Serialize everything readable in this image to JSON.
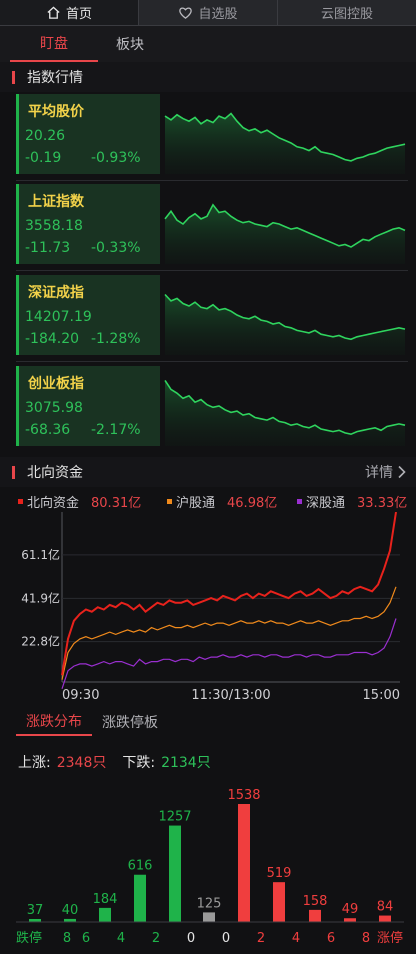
{
  "topnav": {
    "tabs": [
      {
        "label": "首页",
        "icon": "home-icon",
        "active": true
      },
      {
        "label": "自选股",
        "icon": "heart-icon",
        "active": false
      },
      {
        "label": "云图控股",
        "icon": "",
        "active": false
      }
    ]
  },
  "subtabs": [
    {
      "label": "盯盘",
      "active": true
    },
    {
      "label": "板块",
      "active": false
    }
  ],
  "index_section": {
    "title": "指数行情"
  },
  "indices": [
    {
      "name": "平均股价",
      "price": "20.26",
      "change": "-0.19",
      "percent": "-0.93%",
      "trend": [
        0.78,
        0.72,
        0.8,
        0.74,
        0.7,
        0.76,
        0.66,
        0.72,
        0.68,
        0.78,
        0.74,
        0.82,
        0.7,
        0.6,
        0.55,
        0.58,
        0.52,
        0.56,
        0.5,
        0.44,
        0.4,
        0.36,
        0.3,
        0.28,
        0.24,
        0.3,
        0.22,
        0.2,
        0.18,
        0.14,
        0.1,
        0.08,
        0.12,
        0.14,
        0.18,
        0.2,
        0.24,
        0.28,
        0.3,
        0.32,
        0.34
      ]
    },
    {
      "name": "上证指数",
      "price": "3558.18",
      "change": "-11.73",
      "percent": "-0.33%",
      "trend": [
        0.58,
        0.7,
        0.56,
        0.5,
        0.6,
        0.66,
        0.58,
        0.62,
        0.8,
        0.68,
        0.7,
        0.62,
        0.56,
        0.52,
        0.54,
        0.5,
        0.48,
        0.46,
        0.52,
        0.5,
        0.46,
        0.42,
        0.44,
        0.4,
        0.36,
        0.32,
        0.28,
        0.24,
        0.2,
        0.16,
        0.18,
        0.14,
        0.2,
        0.26,
        0.24,
        0.3,
        0.34,
        0.38,
        0.42,
        0.44,
        0.4
      ]
    },
    {
      "name": "深证成指",
      "price": "14207.19",
      "change": "-184.20",
      "percent": "-1.28%",
      "trend": [
        0.82,
        0.72,
        0.76,
        0.68,
        0.64,
        0.7,
        0.62,
        0.6,
        0.66,
        0.58,
        0.6,
        0.56,
        0.5,
        0.46,
        0.44,
        0.48,
        0.42,
        0.4,
        0.36,
        0.38,
        0.32,
        0.3,
        0.26,
        0.24,
        0.22,
        0.26,
        0.2,
        0.18,
        0.16,
        0.18,
        0.14,
        0.12,
        0.16,
        0.18,
        0.2,
        0.22,
        0.24,
        0.26,
        0.28,
        0.3,
        0.28
      ]
    },
    {
      "name": "创业板指",
      "price": "3075.98",
      "change": "-68.36",
      "percent": "-2.17%",
      "trend": [
        0.9,
        0.76,
        0.7,
        0.62,
        0.66,
        0.56,
        0.6,
        0.52,
        0.48,
        0.5,
        0.44,
        0.4,
        0.42,
        0.36,
        0.38,
        0.32,
        0.3,
        0.28,
        0.32,
        0.26,
        0.24,
        0.2,
        0.22,
        0.18,
        0.16,
        0.2,
        0.14,
        0.12,
        0.1,
        0.12,
        0.08,
        0.06,
        0.1,
        0.12,
        0.14,
        0.16,
        0.12,
        0.18,
        0.2,
        0.22,
        0.2
      ]
    }
  ],
  "north_section": {
    "title": "北向资金",
    "more": "详情"
  },
  "north_legend": [
    {
      "label": "北向资金",
      "value": "80.31亿",
      "color": "#e8221c"
    },
    {
      "label": "沪股通",
      "value": "46.98亿",
      "color": "#f08a1c"
    },
    {
      "label": "深股通",
      "value": "33.33亿",
      "color": "#9a2fd0"
    }
  ],
  "chart_data": [
    {
      "type": "line",
      "y_tick_labels": [
        "61.1亿",
        "41.9亿",
        "22.8亿"
      ],
      "y_ticks": [
        61.1,
        41.9,
        22.8
      ],
      "x_tick_labels": [
        "09:30",
        "11:30/13:00",
        "15:00"
      ],
      "ylim": [
        5,
        80
      ],
      "series": [
        {
          "name": "北向资金",
          "color": "#e8221c",
          "values": [
            8,
            24,
            32,
            35,
            37,
            36,
            38,
            37,
            39,
            38,
            40,
            39,
            37,
            39,
            36,
            38,
            40,
            39,
            41,
            40,
            40,
            41,
            39,
            40,
            41,
            42,
            41,
            43,
            42,
            41,
            43,
            44,
            42,
            44,
            43,
            45,
            44,
            43,
            42,
            44,
            45,
            43,
            44,
            46,
            44,
            42,
            43,
            45,
            44,
            46,
            47,
            46,
            45,
            48,
            55,
            63,
            80
          ]
        },
        {
          "name": "沪股通",
          "color": "#f08a1c",
          "values": [
            6,
            18,
            22,
            24,
            25,
            24,
            25,
            26,
            27,
            26,
            27,
            28,
            27,
            28,
            27,
            29,
            28,
            29,
            30,
            29,
            29,
            30,
            29,
            30,
            31,
            30,
            31,
            31,
            30,
            31,
            32,
            31,
            31,
            32,
            31,
            32,
            31,
            31,
            30,
            31,
            32,
            31,
            31,
            32,
            31,
            30,
            31,
            32,
            32,
            33,
            33,
            34,
            33,
            34,
            36,
            40,
            47
          ]
        },
        {
          "name": "深股通",
          "color": "#9a2fd0",
          "values": [
            2,
            10,
            12,
            13,
            13,
            12,
            13,
            14,
            13,
            14,
            14,
            13,
            12,
            15,
            13,
            14,
            14,
            15,
            15,
            14,
            15,
            15,
            14,
            16,
            15,
            16,
            16,
            17,
            16,
            16,
            17,
            16,
            17,
            17,
            16,
            17,
            17,
            16,
            16,
            17,
            17,
            16,
            17,
            17,
            16,
            16,
            17,
            17,
            17,
            18,
            18,
            18,
            17,
            18,
            20,
            25,
            33
          ]
        }
      ]
    },
    {
      "type": "bar",
      "categories": [
        "跌停",
        "8",
        "6",
        "4",
        "2",
        "0",
        "0",
        "2",
        "4",
        "6",
        "8",
        "涨停"
      ],
      "values": [
        37,
        40,
        184,
        616,
        1257,
        125,
        1538,
        519,
        158,
        49,
        84
      ],
      "ylim": [
        0,
        1538
      ]
    }
  ],
  "dist_tabs": [
    {
      "label": "涨跌分布",
      "active": true
    },
    {
      "label": "涨跌停板",
      "active": false
    }
  ],
  "updown": {
    "up_label": "上涨:",
    "up_value": "2348只",
    "down_label": "下跌:",
    "down_value": "2134只"
  },
  "dist_colors": {
    "down": "#1fb34a",
    "flat": "#9a9a9a",
    "up": "#f03e3e"
  }
}
